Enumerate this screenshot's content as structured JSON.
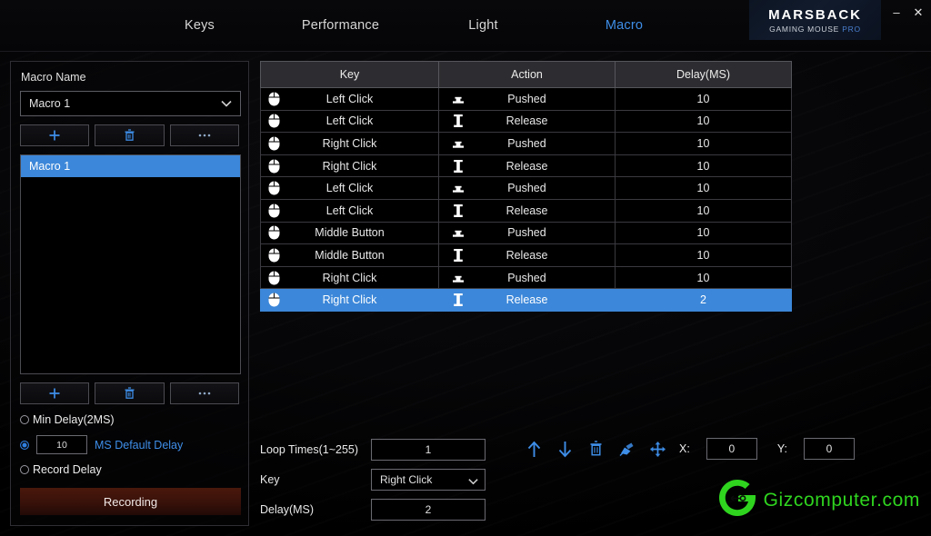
{
  "titlebar": {
    "tabs": [
      {
        "id": "keys",
        "label": "Keys",
        "active": false
      },
      {
        "id": "performance",
        "label": "Performance",
        "active": false
      },
      {
        "id": "light",
        "label": "Light",
        "active": false
      },
      {
        "id": "macro",
        "label": "Macro",
        "active": true
      }
    ],
    "brand_main": "MARSBACK",
    "brand_sub": "GAMING MOUSE",
    "brand_pro": "PRO",
    "minimize_glyph": "–",
    "close_glyph": "✕",
    "minimize_icon": "minimize-icon",
    "close_icon": "close-icon"
  },
  "left_panel": {
    "title": "Macro Name",
    "macro_select_value": "Macro 1",
    "top_buttons": [
      {
        "icon": "plus-icon",
        "label": "+"
      },
      {
        "icon": "trash-icon",
        "label": ""
      },
      {
        "icon": "ellipsis-icon",
        "label": "•••"
      }
    ],
    "macro_list": [
      {
        "label": "Macro 1",
        "selected": true
      }
    ],
    "bottom_buttons": [
      {
        "icon": "plus-icon",
        "label": "+"
      },
      {
        "icon": "trash-icon",
        "label": ""
      },
      {
        "icon": "ellipsis-icon",
        "label": "•••"
      }
    ],
    "delay_options": [
      {
        "id": "min-delay",
        "label": "Min Delay(2MS)",
        "selected": false,
        "blue": false
      },
      {
        "id": "default-delay",
        "label": "MS Default Delay",
        "selected": true,
        "blue": true,
        "value": "10"
      },
      {
        "id": "record-delay",
        "label": "Record Delay",
        "selected": false,
        "blue": false
      }
    ],
    "recording_label": "Recording"
  },
  "table": {
    "columns": [
      "Key",
      "Action",
      "Delay(MS)"
    ],
    "rows": [
      {
        "key": "Left Click",
        "action": "Pushed",
        "delay": "10",
        "selected": false
      },
      {
        "key": "Left Click",
        "action": "Release",
        "delay": "10",
        "selected": false
      },
      {
        "key": "Right Click",
        "action": "Pushed",
        "delay": "10",
        "selected": false
      },
      {
        "key": "Right Click",
        "action": "Release",
        "delay": "10",
        "selected": false
      },
      {
        "key": "Left Click",
        "action": "Pushed",
        "delay": "10",
        "selected": false
      },
      {
        "key": "Left Click",
        "action": "Release",
        "delay": "10",
        "selected": false
      },
      {
        "key": "Middle Button",
        "action": "Pushed",
        "delay": "10",
        "selected": false
      },
      {
        "key": "Middle Button",
        "action": "Release",
        "delay": "10",
        "selected": false
      },
      {
        "key": "Right Click",
        "action": "Pushed",
        "delay": "10",
        "selected": false
      },
      {
        "key": "Right Click",
        "action": "Release",
        "delay": "2",
        "selected": true
      }
    ]
  },
  "bottom_controls": {
    "loop_times_label": "Loop Times(1~255)",
    "loop_times_value": "1",
    "key_label": "Key",
    "key_value": "Right Click",
    "delay_label": "Delay(MS)",
    "delay_value": "2",
    "toolbar_icons": [
      "arrow-up-icon",
      "arrow-down-icon",
      "trash-icon",
      "eraser-icon",
      "move-icon"
    ],
    "x_label": "X:",
    "x_value": "0",
    "y_label": "Y:",
    "y_value": "0"
  },
  "watermark": {
    "text": "Gizcomputer.com",
    "logo_icon": "gizcomputer-logo-icon",
    "color": "#2fd41f"
  },
  "colors": {
    "accent_blue": "#3e8ee8",
    "selection_blue": "#3c87d9",
    "recording_red": "#4a180c",
    "background": "#060608"
  }
}
